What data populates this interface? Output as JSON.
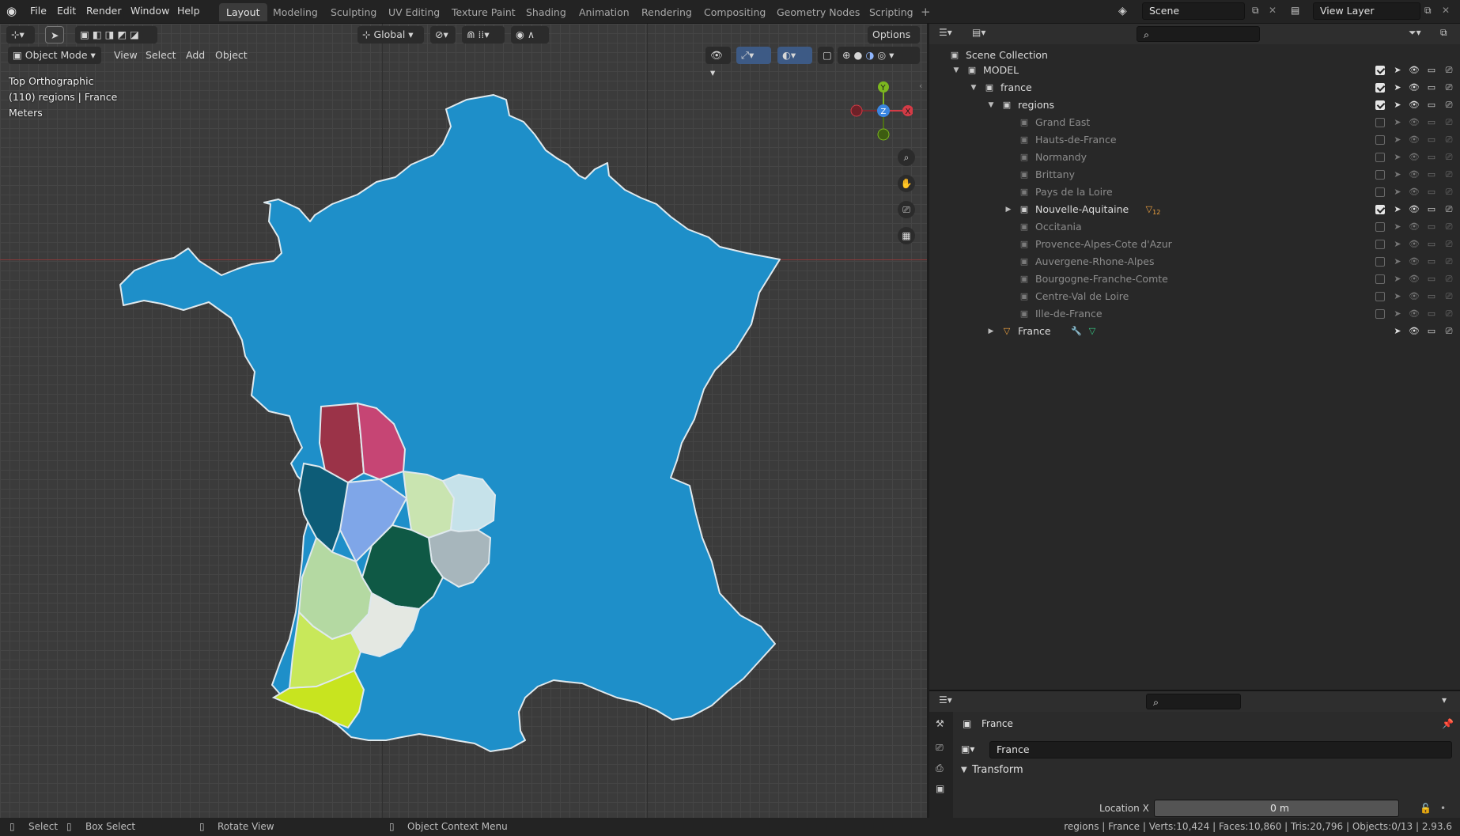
{
  "menu": {
    "items": [
      "File",
      "Edit",
      "Render",
      "Window",
      "Help"
    ]
  },
  "workspaces": [
    "Layout",
    "Modeling",
    "Sculpting",
    "UV Editing",
    "Texture Paint",
    "Shading",
    "Animation",
    "Rendering",
    "Compositing",
    "Geometry Nodes",
    "Scripting"
  ],
  "active_workspace": "Layout",
  "scene": {
    "name": "Scene",
    "view_layer": "View Layer"
  },
  "toolbar": {
    "orientation": "Global",
    "options": "Options"
  },
  "viewport_header": {
    "mode": "Object Mode",
    "menus": [
      "View",
      "Select",
      "Add",
      "Object"
    ]
  },
  "viewport": {
    "view_name": "Top Orthographic",
    "info": "(110) regions | France",
    "units": "Meters"
  },
  "outliner": {
    "root": "Scene Collection",
    "rows": [
      {
        "label": "MODEL",
        "level": 0,
        "expand": "open",
        "checked": true,
        "dim": false
      },
      {
        "label": "france",
        "level": 1,
        "expand": "open",
        "checked": true,
        "dim": false
      },
      {
        "label": "regions",
        "level": 2,
        "expand": "open",
        "checked": true,
        "dim": false
      },
      {
        "label": "Grand East",
        "level": 3,
        "expand": "",
        "checked": false,
        "dim": true
      },
      {
        "label": "Hauts-de-France",
        "level": 3,
        "expand": "",
        "checked": false,
        "dim": true
      },
      {
        "label": "Normandy",
        "level": 3,
        "expand": "",
        "checked": false,
        "dim": true
      },
      {
        "label": "Brittany",
        "level": 3,
        "expand": "",
        "checked": false,
        "dim": true
      },
      {
        "label": "Pays de la Loire",
        "level": 3,
        "expand": "",
        "checked": false,
        "dim": true
      },
      {
        "label": "Nouvelle-Aquitaine",
        "level": 3,
        "expand": "closed",
        "checked": true,
        "dim": false,
        "badge": "12"
      },
      {
        "label": "Occitania",
        "level": 3,
        "expand": "",
        "checked": false,
        "dim": true
      },
      {
        "label": "Provence-Alpes-Cote d'Azur",
        "level": 3,
        "expand": "",
        "checked": false,
        "dim": true
      },
      {
        "label": "Auvergene-Rhone-Alpes",
        "level": 3,
        "expand": "",
        "checked": false,
        "dim": true
      },
      {
        "label": "Bourgogne-Franche-Comte",
        "level": 3,
        "expand": "",
        "checked": false,
        "dim": true
      },
      {
        "label": "Centre-Val de Loire",
        "level": 3,
        "expand": "",
        "checked": false,
        "dim": true
      },
      {
        "label": "Ille-de-France",
        "level": 3,
        "expand": "",
        "checked": false,
        "dim": true
      },
      {
        "label": "France",
        "level": 2,
        "expand": "closed",
        "checked": null,
        "dim": false,
        "object": true
      }
    ]
  },
  "properties": {
    "object_name": "France",
    "data_name": "France",
    "panel": "Transform",
    "field_label": "Location X",
    "field_value": "0 m"
  },
  "statusbar": {
    "select": "Select",
    "box_select": "Box Select",
    "rotate": "Rotate View",
    "context": "Object Context Menu",
    "stats": "regions | France | Verts:10,424 | Faces:10,860 | Tris:20,796 | Objects:0/13 | 2.93.6"
  },
  "colors": {
    "france": "#1e8fc9",
    "accent": "#4772b3",
    "axis_x": "#d43b46",
    "axis_y": "#7cb71f",
    "axis_z": "#3a86e0"
  }
}
